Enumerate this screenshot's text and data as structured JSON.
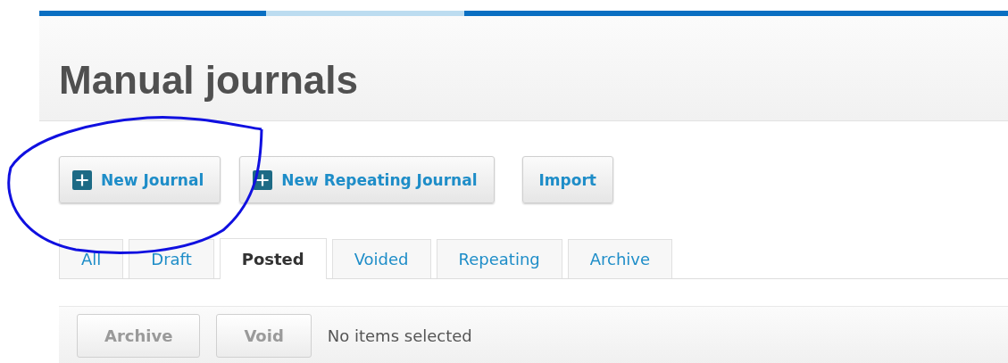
{
  "page": {
    "title": "Manual journals"
  },
  "actions": [
    {
      "label": "New Journal",
      "kind": "add"
    },
    {
      "label": "New Repeating Journal",
      "kind": "add"
    },
    {
      "label": "Import",
      "kind": "plain"
    }
  ],
  "tabs": [
    {
      "label": "All",
      "selected": false
    },
    {
      "label": "Draft",
      "selected": false
    },
    {
      "label": "Posted",
      "selected": true
    },
    {
      "label": "Voided",
      "selected": false
    },
    {
      "label": "Repeating",
      "selected": false
    },
    {
      "label": "Archive",
      "selected": false
    }
  ],
  "bulk_bar": {
    "buttons": [
      {
        "label": "Archive",
        "disabled": true
      },
      {
        "label": "Void",
        "disabled": true
      }
    ],
    "status": "No items selected"
  }
}
